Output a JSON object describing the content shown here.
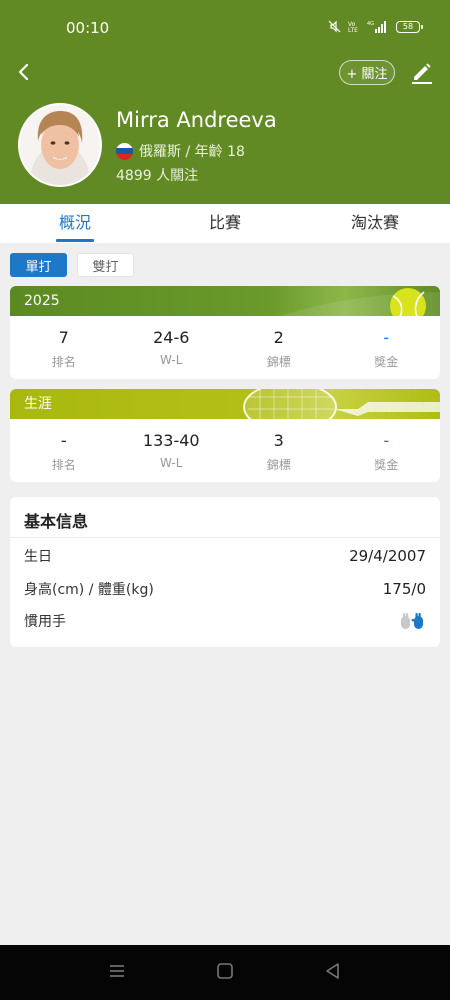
{
  "status_bar": {
    "time": "00:10",
    "battery": "58"
  },
  "header": {
    "follow_label": "+ 關注",
    "player_name": "Mirra Andreeva",
    "nationality_age": "俄羅斯 / 年齡 18",
    "followers": "4899 人關注",
    "accent_color": "#628a24"
  },
  "tabs": [
    {
      "label": "概況",
      "active": true
    },
    {
      "label": "比賽",
      "active": false
    },
    {
      "label": "淘汰賽",
      "active": false
    }
  ],
  "toggles": {
    "singles": "單打",
    "doubles": "雙打"
  },
  "season_stats": {
    "title": "2025",
    "items": [
      {
        "value": "7",
        "label": "排名"
      },
      {
        "value": "24-6",
        "label": "W-L"
      },
      {
        "value": "2",
        "label": "錦標"
      },
      {
        "value": "-",
        "label": "獎金"
      }
    ]
  },
  "career_stats": {
    "title": "生涯",
    "items": [
      {
        "value": "-",
        "label": "排名"
      },
      {
        "value": "133-40",
        "label": "W-L"
      },
      {
        "value": "3",
        "label": "錦標"
      },
      {
        "value": "-",
        "label": "獎金"
      }
    ]
  },
  "basic_info": {
    "title": "基本信息",
    "rows": [
      {
        "label": "生日",
        "value": "29/4/2007"
      },
      {
        "label": "身高(cm) / 體重(kg)",
        "value": "175/0"
      },
      {
        "label": "慣用手",
        "value": ""
      }
    ],
    "handedness_icon": "right-hand-icon"
  }
}
